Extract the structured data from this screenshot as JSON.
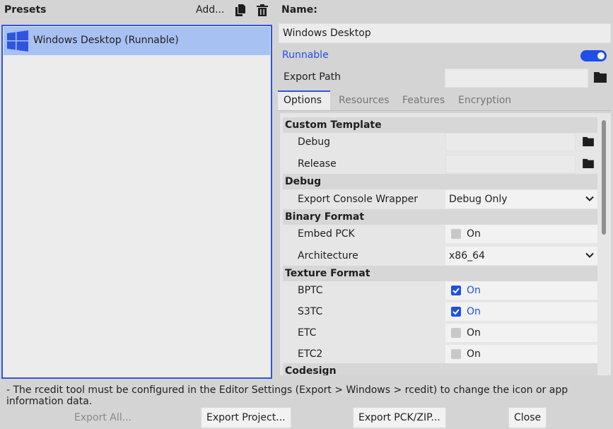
{
  "presets": {
    "title": "Presets",
    "add_label": "Add...",
    "items": [
      {
        "label": "Windows Desktop (Runnable)"
      }
    ]
  },
  "details": {
    "name_label": "Name:",
    "name_value": "Windows Desktop",
    "runnable_label": "Runnable",
    "runnable_on": true,
    "export_path_label": "Export Path",
    "export_path_value": ""
  },
  "tabs": [
    "Options",
    "Resources",
    "Features",
    "Encryption"
  ],
  "options": {
    "custom_template": {
      "section": "Custom Template",
      "debug_label": "Debug",
      "release_label": "Release"
    },
    "debug": {
      "section": "Debug",
      "console_wrapper_label": "Export Console Wrapper",
      "console_wrapper_value": "Debug Only"
    },
    "binary_format": {
      "section": "Binary Format",
      "embed_pck_label": "Embed PCK",
      "embed_pck_state": "On",
      "architecture_label": "Architecture",
      "architecture_value": "x86_64"
    },
    "texture_format": {
      "section": "Texture Format",
      "bptc_label": "BPTC",
      "bptc_state": "On",
      "s3tc_label": "S3TC",
      "s3tc_state": "On",
      "etc_label": "ETC",
      "etc_state": "On",
      "etc2_label": "ETC2",
      "etc2_state": "On"
    },
    "codesign": {
      "section": "Codesign"
    }
  },
  "hint": "- The rcedit tool must be configured in the Editor Settings (Export > Windows > rcedit) to change the icon or app information data.",
  "buttons": {
    "export_all": "Export All...",
    "export_project": "Export Project...",
    "export_pck_zip": "Export PCK/ZIP...",
    "close": "Close"
  },
  "colors": {
    "accent": "#1f4fe8",
    "selection": "#a8c1f3",
    "border_focus": "#2f55e0"
  }
}
